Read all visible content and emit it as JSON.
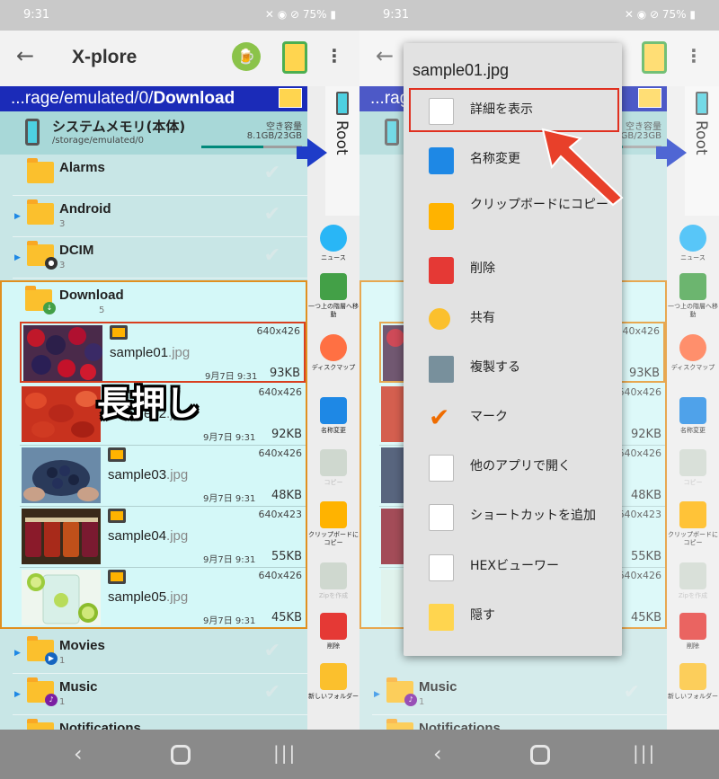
{
  "status": {
    "time": "9:31",
    "battery": "75%"
  },
  "appbar": {
    "title": "X-plore"
  },
  "path": {
    "prefix": "...rage/emulated/0/",
    "bold": "Download"
  },
  "storage": {
    "name": "システムメモリ(本体)",
    "path": "/storage/emulated/0",
    "free_label": "空き容量",
    "free_value": "8.1GB/23GB"
  },
  "root_label": "Root",
  "folders_top": [
    {
      "name": "Alarms",
      "count": ""
    },
    {
      "name": "Android",
      "count": "3"
    },
    {
      "name": "DCIM",
      "count": "3"
    }
  ],
  "download": {
    "name": "Download",
    "count": "5"
  },
  "files": [
    {
      "base": "sample01",
      "ext": ".jpg",
      "res": "640x426",
      "date": "9月7日 9:31",
      "size": "93KB"
    },
    {
      "base": "sample02",
      "ext": ".jpg",
      "res": "640x426",
      "date": "9月7日 9:31",
      "size": "92KB"
    },
    {
      "base": "sample03",
      "ext": ".jpg",
      "res": "640x426",
      "date": "9月7日 9:31",
      "size": "48KB"
    },
    {
      "base": "sample04",
      "ext": ".jpg",
      "res": "640x423",
      "date": "9月7日 9:31",
      "size": "55KB"
    },
    {
      "base": "sample05",
      "ext": ".jpg",
      "res": "640x426",
      "date": "9月7日 9:31",
      "size": "45KB"
    }
  ],
  "folders_bottom": [
    {
      "name": "Movies",
      "count": "1"
    },
    {
      "name": "Music",
      "count": "1"
    },
    {
      "name": "Notifications",
      "count": ""
    }
  ],
  "annotation": "長押し",
  "tools": [
    {
      "label": "ニュース",
      "icon": "info-icon"
    },
    {
      "label": "一つ上の階層へ移動",
      "icon": "up-arrow-icon"
    },
    {
      "label": "ディスクマップ",
      "icon": "disk-map-icon"
    },
    {
      "label": "名称変更",
      "icon": "rename-icon"
    },
    {
      "label": "コピー",
      "icon": "copy-icon"
    },
    {
      "label": "クリップボードにコピー",
      "icon": "clipboard-icon"
    },
    {
      "label": "Zipを作成",
      "icon": "zip-icon"
    },
    {
      "label": "削除",
      "icon": "trash-icon"
    },
    {
      "label": "新しいフォルダー",
      "icon": "new-folder-icon"
    }
  ],
  "menu": {
    "title": "sample01.jpg",
    "items": [
      {
        "label": "詳細を表示",
        "icon": "details-icon"
      },
      {
        "label": "名称変更",
        "icon": "rename-icon"
      },
      {
        "label": "クリップボードにコピー",
        "icon": "clipboard-icon"
      },
      {
        "label": "削除",
        "icon": "trash-icon"
      },
      {
        "label": "共有",
        "icon": "share-icon"
      },
      {
        "label": "複製する",
        "icon": "duplicate-icon"
      },
      {
        "label": "マーク",
        "icon": "check-icon"
      },
      {
        "label": "他のアプリで開く",
        "icon": "open-with-icon"
      },
      {
        "label": "ショートカットを追加",
        "icon": "shortcut-icon"
      },
      {
        "label": "HEXビューワー",
        "icon": "hex-viewer-icon"
      },
      {
        "label": "隠す",
        "icon": "hide-icon"
      }
    ]
  },
  "colors": {
    "accent": "#1b2bb8",
    "highlight": "#e03020",
    "selection": "#e09020"
  }
}
